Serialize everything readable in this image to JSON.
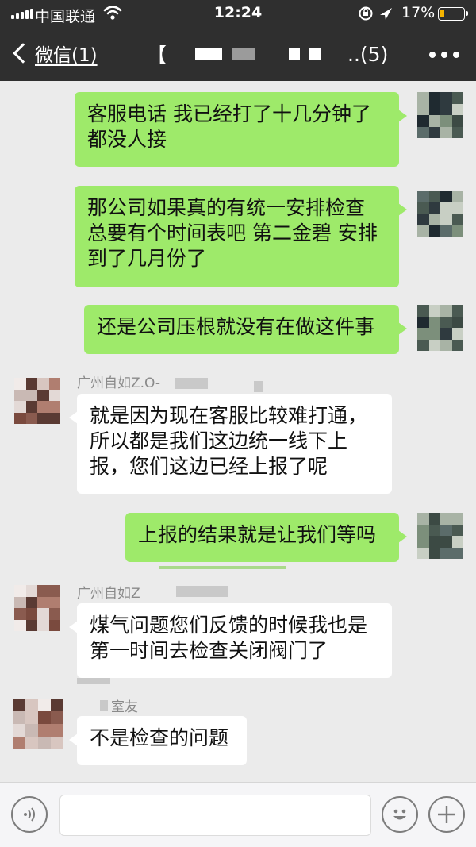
{
  "status_bar": {
    "carrier": "中国联通",
    "time": "12:24",
    "battery_percent": "17%",
    "battery_level": 0.17,
    "icons": [
      "signal-icon",
      "wifi-icon",
      "location-lock-icon",
      "location-arrow-icon",
      "battery-icon"
    ]
  },
  "nav": {
    "back_label": "微信(1)",
    "title_prefix": "【",
    "title_count": "..(5)",
    "more_icon": "more-dots-icon"
  },
  "messages": [
    {
      "side": "sent",
      "text": [
        "客服电话 我已经打了十几分钟了",
        "都没人接"
      ]
    },
    {
      "side": "sent",
      "text": [
        "那公司如果真的有统一安排检查",
        "总要有个时间表吧 第二金碧 安排",
        "到了几月份了"
      ]
    },
    {
      "side": "sent",
      "text": [
        "还是公司压根就没有在做这件事"
      ]
    },
    {
      "side": "recv",
      "sender": "广州自如Z.O-",
      "text": [
        "就是因为现在客服比较难打通，",
        "所以都是我们这边统一线下上",
        "报，您们这边已经上报了呢"
      ]
    },
    {
      "side": "sent",
      "text": [
        "上报的结果就是让我们等吗"
      ]
    },
    {
      "side": "recv",
      "sender": "广州自如Z",
      "text": [
        "煤气问题您们反馈的时候我也是",
        "第一时间去检查关闭阀门了"
      ]
    },
    {
      "side": "recv",
      "sender": "室友",
      "text": [
        "不是检查的问题"
      ]
    }
  ],
  "input_bar": {
    "voice_icon": "voice-icon",
    "emoji_icon": "emoji-icon",
    "plus_icon": "plus-icon"
  },
  "colors": {
    "nav_bg": "#2f2f2f",
    "chat_bg": "#ebebeb",
    "sent_bubble": "#9eea6a",
    "recv_bubble": "#ffffff",
    "battery": "#f5b400"
  }
}
